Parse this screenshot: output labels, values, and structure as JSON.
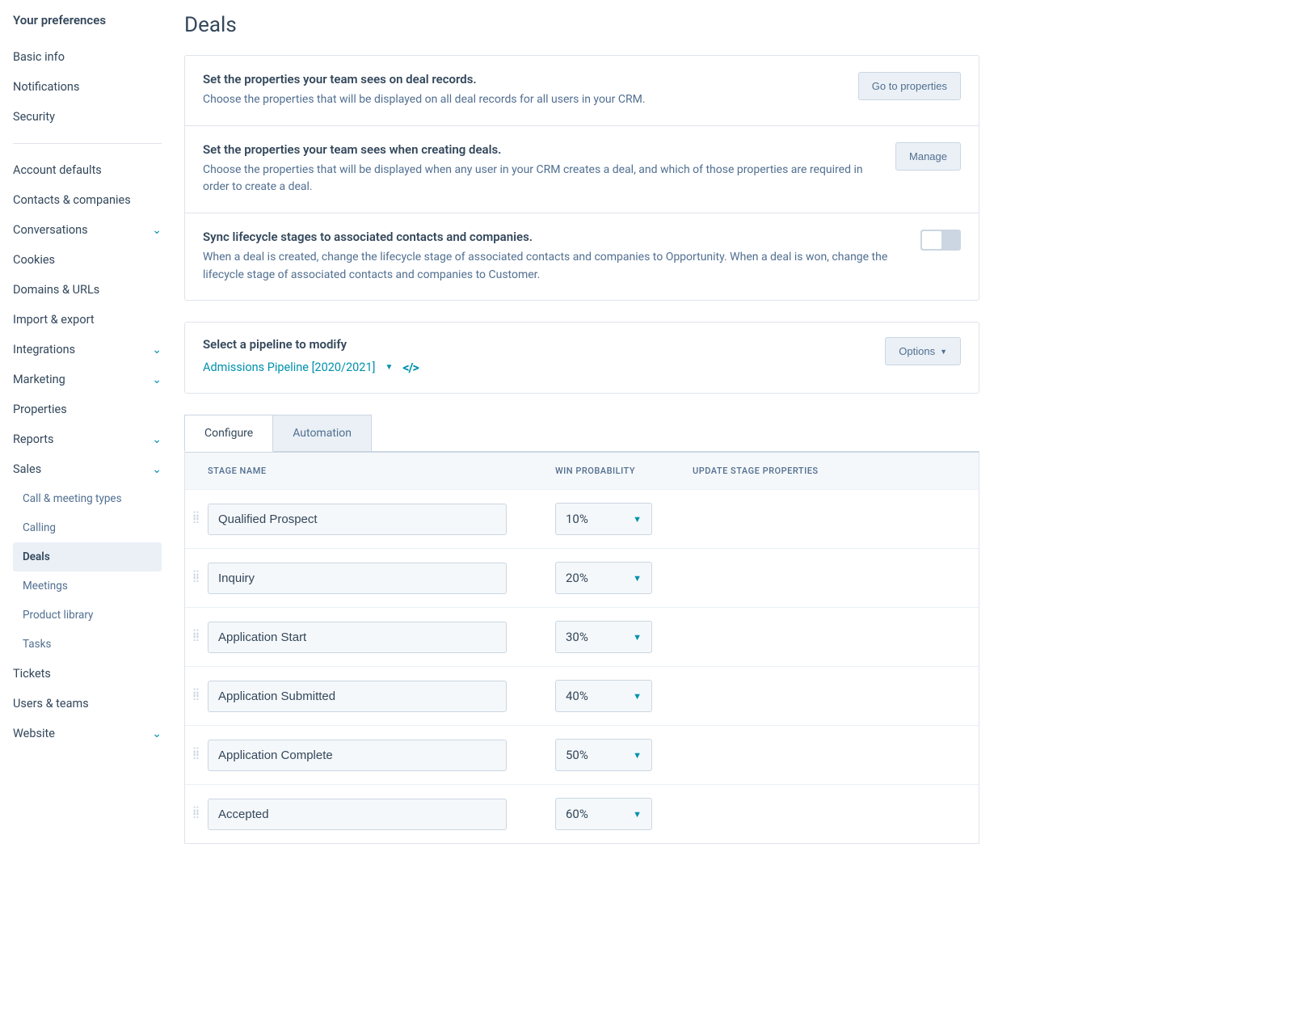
{
  "sidebar": {
    "heading": "Your preferences",
    "topItems": [
      {
        "label": "Basic info"
      },
      {
        "label": "Notifications"
      },
      {
        "label": "Security"
      }
    ],
    "items": [
      {
        "label": "Account defaults",
        "expandable": false
      },
      {
        "label": "Contacts & companies",
        "expandable": false
      },
      {
        "label": "Conversations",
        "expandable": true
      },
      {
        "label": "Cookies",
        "expandable": false
      },
      {
        "label": "Domains & URLs",
        "expandable": false
      },
      {
        "label": "Import & export",
        "expandable": false
      },
      {
        "label": "Integrations",
        "expandable": true
      },
      {
        "label": "Marketing",
        "expandable": true
      },
      {
        "label": "Properties",
        "expandable": false
      },
      {
        "label": "Reports",
        "expandable": true
      },
      {
        "label": "Sales",
        "expandable": true,
        "expanded": true,
        "children": [
          {
            "label": "Call & meeting types"
          },
          {
            "label": "Calling"
          },
          {
            "label": "Deals",
            "active": true
          },
          {
            "label": "Meetings"
          },
          {
            "label": "Product library"
          },
          {
            "label": "Tasks"
          }
        ]
      },
      {
        "label": "Tickets",
        "expandable": false
      },
      {
        "label": "Users & teams",
        "expandable": false
      },
      {
        "label": "Website",
        "expandable": true
      }
    ]
  },
  "page": {
    "title": "Deals",
    "cards": [
      {
        "title": "Set the properties your team sees on deal records.",
        "desc": "Choose the properties that will be displayed on all deal records for all users in your CRM.",
        "action": {
          "type": "button",
          "label": "Go to properties"
        }
      },
      {
        "title": "Set the properties your team sees when creating deals.",
        "desc": "Choose the properties that will be displayed when any user in your CRM creates a deal, and which of those properties are required in order to create a deal.",
        "action": {
          "type": "button",
          "label": "Manage"
        }
      },
      {
        "title": "Sync lifecycle stages to associated contacts and companies.",
        "desc": "When a deal is created, change the lifecycle stage of associated contacts and companies to Opportunity. When a deal is won, change the lifecycle stage of associated contacts and companies to Customer.",
        "action": {
          "type": "toggle",
          "on": false
        }
      }
    ],
    "pipeline": {
      "heading": "Select a pipeline to modify",
      "selected": "Admissions Pipeline [2020/2021]",
      "optionsLabel": "Options"
    },
    "tabs": [
      {
        "label": "Configure",
        "active": true
      },
      {
        "label": "Automation",
        "active": false
      }
    ],
    "columns": {
      "stageName": "STAGE NAME",
      "winProb": "WIN PROBABILITY",
      "updateProps": "UPDATE STAGE PROPERTIES"
    },
    "stages": [
      {
        "name": "Qualified Prospect",
        "prob": "10%"
      },
      {
        "name": "Inquiry",
        "prob": "20%"
      },
      {
        "name": "Application Start",
        "prob": "30%"
      },
      {
        "name": "Application Submitted",
        "prob": "40%"
      },
      {
        "name": "Application Complete",
        "prob": "50%"
      },
      {
        "name": "Accepted",
        "prob": "60%"
      }
    ]
  }
}
